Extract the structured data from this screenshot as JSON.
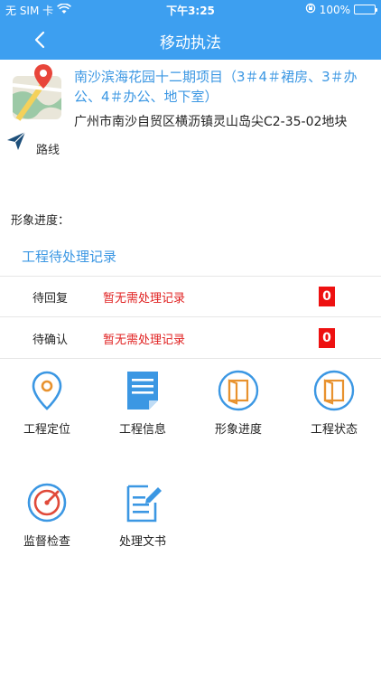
{
  "status_bar": {
    "carrier": "无 SIM 卡",
    "time": "下午3:25",
    "battery": "100%"
  },
  "nav": {
    "title": "移动执法"
  },
  "project": {
    "name": "南沙滨海花园十二期项目（3＃4＃裙房、3＃办公、4＃办公、地下室）",
    "address": "广州市南沙自贸区横沥镇灵山岛尖C2-35-02地块",
    "route_label": "路线"
  },
  "progress_label": "形象进度：",
  "records": {
    "title": "工程待处理记录",
    "rows": [
      {
        "label": "待回复",
        "message": "暂无需处理记录",
        "count": "0"
      },
      {
        "label": "待确认",
        "message": "暂无需处理记录",
        "count": "0"
      }
    ]
  },
  "menu": [
    {
      "label": "工程定位",
      "icon": "location-pin-icon"
    },
    {
      "label": "工程信息",
      "icon": "document-icon"
    },
    {
      "label": "形象进度",
      "icon": "door-icon"
    },
    {
      "label": "工程状态",
      "icon": "door-icon"
    },
    {
      "label": "监督检查",
      "icon": "gauge-icon"
    },
    {
      "label": "处理文书",
      "icon": "edit-document-icon"
    }
  ],
  "colors": {
    "primary": "#3d9ff0",
    "link": "#3b97e3",
    "alert": "#e02020",
    "badge": "#ee1111",
    "orange": "#e8922e"
  }
}
